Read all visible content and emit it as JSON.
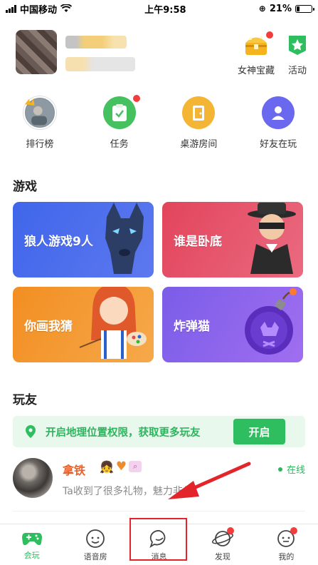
{
  "status_bar": {
    "carrier": "中国移动",
    "time": "上午9:58",
    "battery": "21%",
    "battery_level": 0.21
  },
  "profile": {
    "treasure_label": "女神宝藏",
    "activity_label": "活动"
  },
  "quick_icons": [
    {
      "label": "排行榜",
      "icon": "rank-crown-icon"
    },
    {
      "label": "任务",
      "icon": "task-clipboard-icon"
    },
    {
      "label": "桌游房间",
      "icon": "door-icon"
    },
    {
      "label": "好友在玩",
      "icon": "friend-person-icon"
    }
  ],
  "sections": {
    "games_title": "游戏",
    "friends_title": "玩友"
  },
  "games": [
    {
      "title": "狼人游戏9人",
      "color": "#4a6bea"
    },
    {
      "title": "谁是卧底",
      "color": "#e2556a"
    },
    {
      "title": "你画我猜",
      "color": "#f29a35"
    },
    {
      "title": "炸弹猫",
      "color": "#8f5ee6"
    }
  ],
  "location_banner": {
    "text": "开启地理位置权限，获取更多玩友",
    "button": "开启"
  },
  "friend": {
    "name": "拿铁",
    "status": "在线",
    "description": "Ta收到了很多礼物，魅力非凡"
  },
  "tabs": [
    {
      "label": "会玩",
      "icon": "gamepad-icon",
      "active": true
    },
    {
      "label": "语音房",
      "icon": "voice-room-icon",
      "active": false
    },
    {
      "label": "消息",
      "icon": "message-bubble-icon",
      "active": false
    },
    {
      "label": "发现",
      "icon": "planet-icon",
      "active": false
    },
    {
      "label": "我的",
      "icon": "profile-face-icon",
      "active": false
    }
  ],
  "colors": {
    "accent_green": "#2ebd5f",
    "red_dot": "#f23d3d",
    "annotation_red": "#e3242b"
  }
}
